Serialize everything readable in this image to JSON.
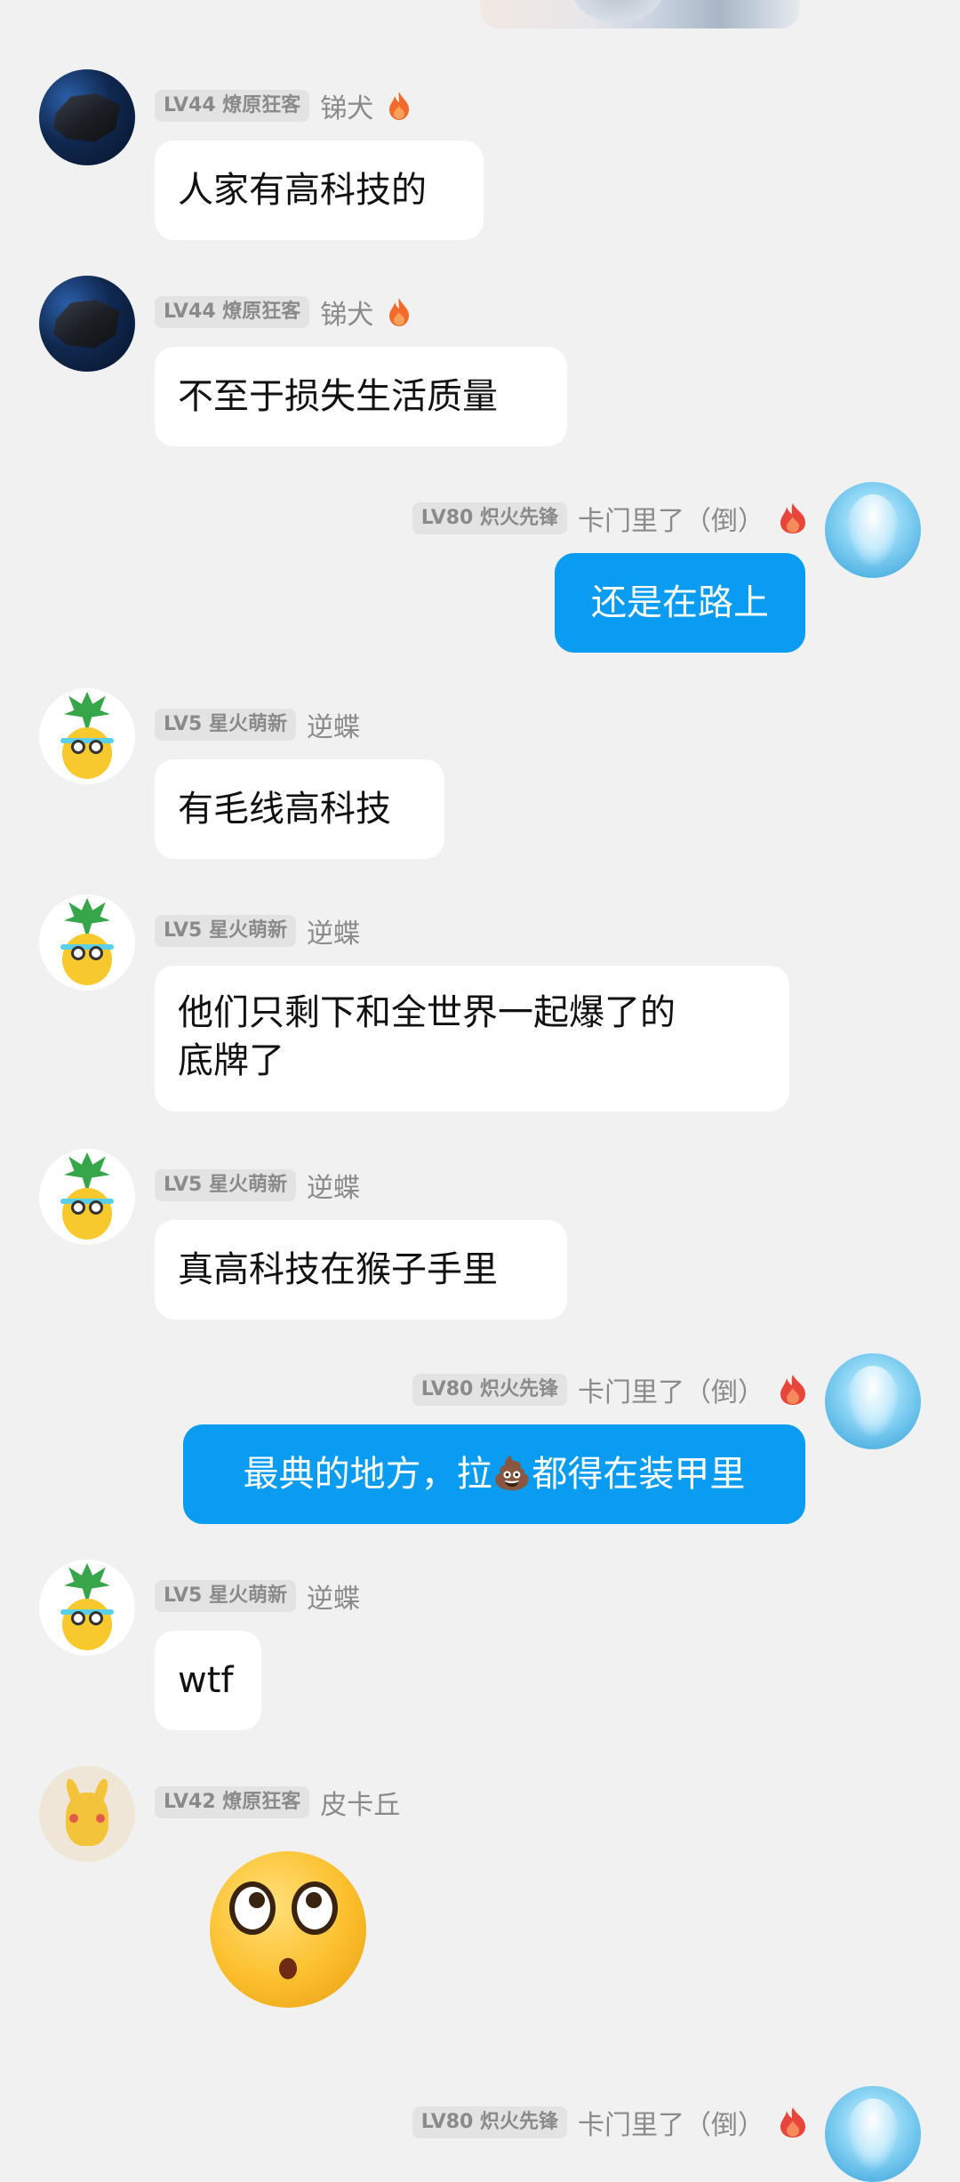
{
  "chat": {
    "messages": [
      {
        "side": "in",
        "badge": "LV44 燎原狂客",
        "sender": "锑犬",
        "flame": "orange",
        "avatar": "mineral-avatar",
        "text": "人家有高科技的"
      },
      {
        "side": "in",
        "badge": "LV44 燎原狂客",
        "sender": "锑犬",
        "flame": "orange",
        "avatar": "mineral-avatar",
        "text": "不至于损失生活质量"
      },
      {
        "side": "out",
        "badge": "LV80 炽火先锋",
        "sender": "卡门里了（倒）",
        "flame": "red",
        "avatar": "water-spirit-avatar",
        "text": "还是在路上"
      },
      {
        "side": "in",
        "badge": "LV5 星火萌新",
        "sender": "逆蝶",
        "avatar": "pineapple-avatar",
        "text": "有毛线高科技"
      },
      {
        "side": "in",
        "badge": "LV5 星火萌新",
        "sender": "逆蝶",
        "avatar": "pineapple-avatar",
        "text_line1": "他们只剩下和全世界一起爆了的",
        "text_line2": "底牌了"
      },
      {
        "side": "in",
        "badge": "LV5 星火萌新",
        "sender": "逆蝶",
        "avatar": "pineapple-avatar",
        "text": "真高科技在猴子手里"
      },
      {
        "side": "out",
        "badge": "LV80 炽火先锋",
        "sender": "卡门里了（倒）",
        "flame": "red",
        "avatar": "water-spirit-avatar",
        "text_before": "最典的地方，拉",
        "emoji": "💩",
        "text_after": "都得在装甲里"
      },
      {
        "side": "in",
        "badge": "LV5 星火萌新",
        "sender": "逆蝶",
        "avatar": "pineapple-avatar",
        "text": "wtf"
      },
      {
        "side": "in",
        "badge": "LV42 燎原狂客",
        "sender": "皮卡丘",
        "avatar": "pikachu-avatar",
        "sticker": "flushed-face-sticker"
      },
      {
        "side": "out",
        "badge": "LV80 炽火先锋",
        "sender": "卡门里了（倒）",
        "flame": "red",
        "avatar": "water-spirit-avatar"
      }
    ]
  },
  "colors": {
    "background": "#f1f1f1",
    "outgoing_bubble": "#0a9cf0",
    "incoming_bubble": "#ffffff",
    "badge_bg": "#e3e3e3",
    "meta_text": "#8a8a8a",
    "flame_orange": "#f26b2a",
    "flame_red": "#e8463a"
  }
}
